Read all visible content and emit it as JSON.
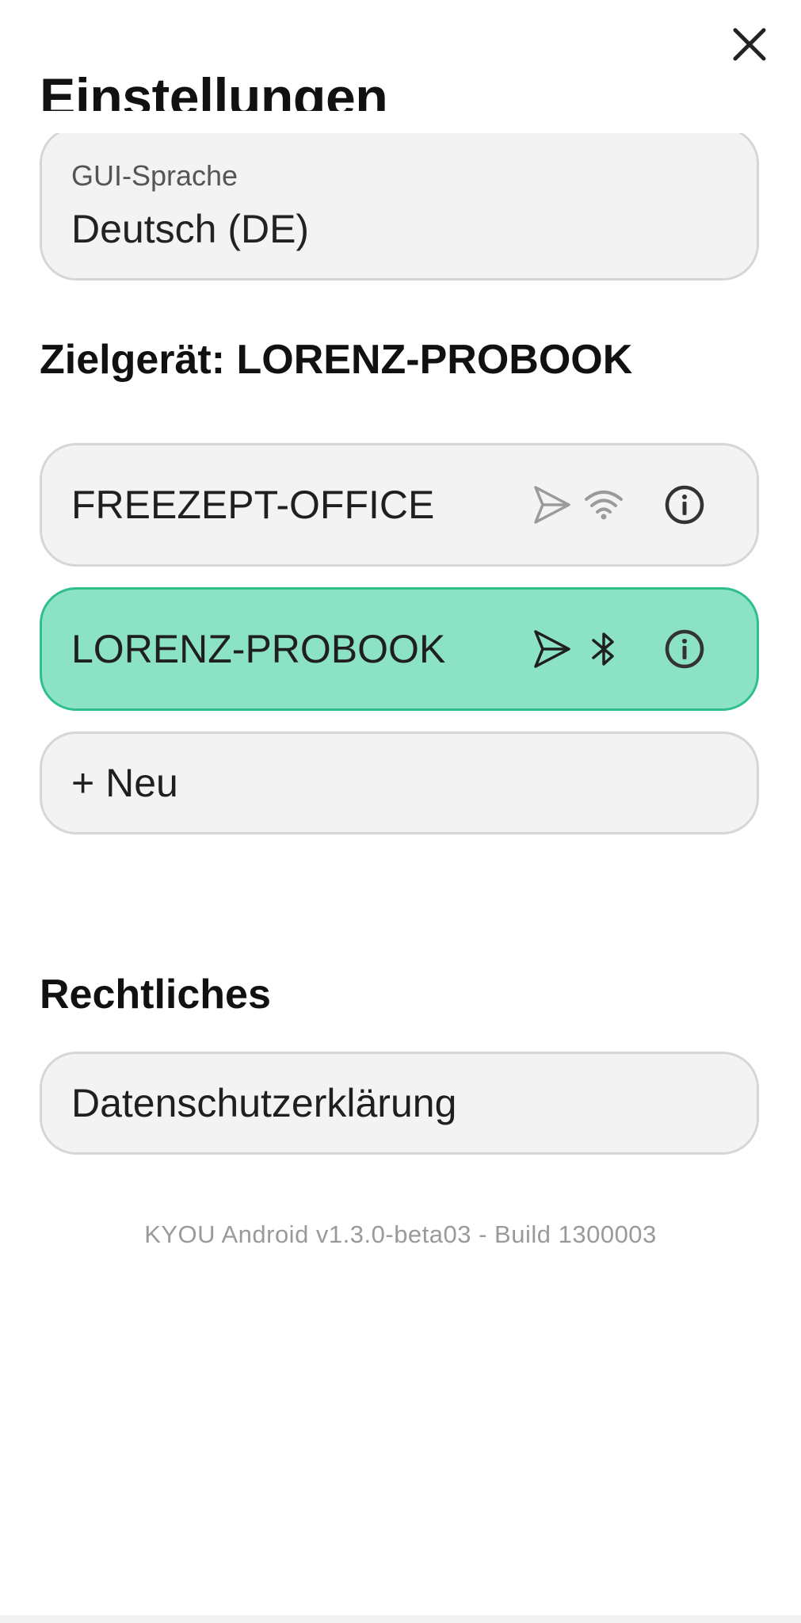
{
  "header": {
    "title": "Einstellungen",
    "close_icon": "close-icon"
  },
  "language": {
    "label": "GUI-Sprache",
    "value": "Deutsch (DE)"
  },
  "target": {
    "heading": "Zielgerät: LORENZ-PROBOOK",
    "devices": [
      {
        "label": "FREEZEPT-OFFICE",
        "send_icon": "send-icon",
        "connection_icon": "wifi-icon",
        "info_icon": "info-icon",
        "selected": false
      },
      {
        "label": "LORENZ-PROBOOK",
        "send_icon": "send-icon",
        "connection_icon": "bluetooth-icon",
        "info_icon": "info-icon",
        "selected": true
      }
    ],
    "new_label": "+ Neu"
  },
  "legal": {
    "heading": "Rechtliches",
    "privacy_label": "Datenschutzerklärung"
  },
  "footer": {
    "version": "KYOU Android v1.3.0-beta03 - Build 1300003"
  },
  "colors": {
    "selected_bg": "#8ce2c5",
    "selected_border": "#2fbf89",
    "field_bg": "#f3f3f3",
    "field_border": "#d6d6d6",
    "muted_text": "#9a9a9a"
  }
}
